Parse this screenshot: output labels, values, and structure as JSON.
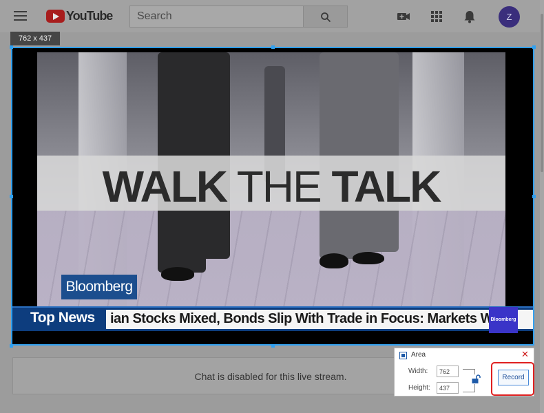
{
  "header": {
    "logo_text": "YouTube",
    "search_placeholder": "Search",
    "avatar_initial": "Z"
  },
  "size_badge": "762 x 437",
  "video": {
    "headline_bold_1": "WALK",
    "headline_thin": "THE",
    "headline_bold_2": "TALK",
    "brand": "Bloomberg",
    "ticker_label": "Top News",
    "ticker_text": "ian Stocks Mixed, Bonds Slip With Trade in Focus: Markets Wrap",
    "ticker_logo": "Bloomberg"
  },
  "chat": {
    "message": "Chat is disabled for this live stream."
  },
  "area_panel": {
    "title": "Area",
    "close_glyph": "✕",
    "width_label": "Width:",
    "width_value": "762",
    "height_label": "Height:",
    "height_value": "437",
    "record_label": "Record"
  },
  "colors": {
    "selection": "#30a0f0",
    "record_highlight": "#e02020",
    "bloomberg_blue": "#1c4e8e"
  }
}
